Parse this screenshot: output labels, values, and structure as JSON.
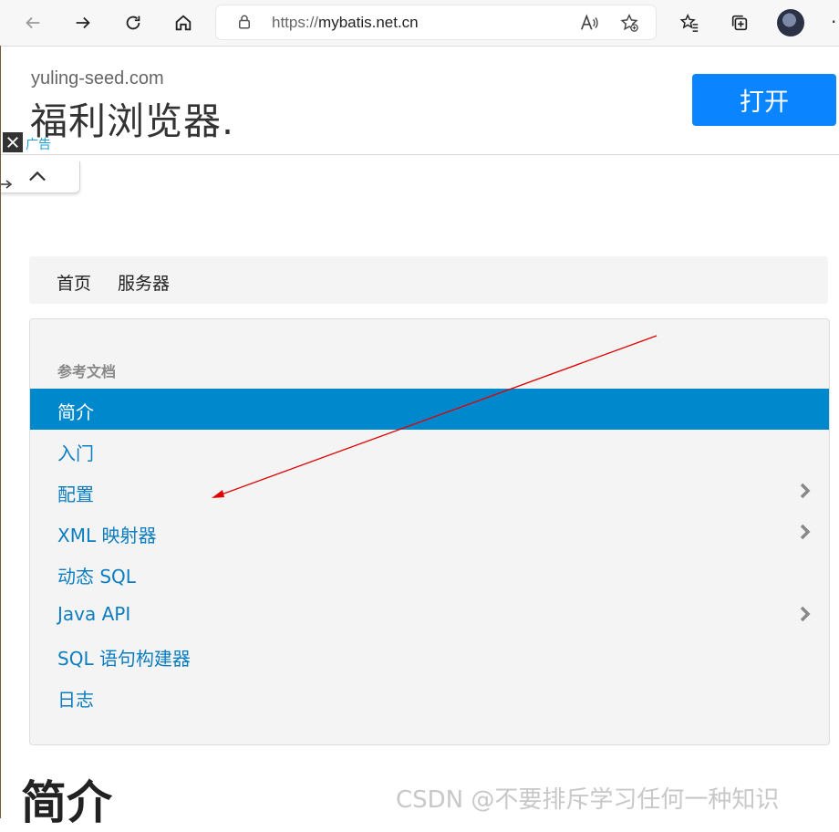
{
  "browser": {
    "url_scheme": "https://",
    "url_host": "mybatis.net.cn",
    "icons": [
      "back-icon",
      "forward-icon",
      "refresh-icon",
      "home-icon",
      "lock-icon",
      "read-aloud-icon",
      "add-favorite-icon",
      "favorites-icon",
      "collections-icon",
      "profile-avatar",
      "more-icon"
    ]
  },
  "ad": {
    "domain": "yuling-seed.com",
    "title": "福利浏览器.",
    "open_label": "打开",
    "ad_label": "广告"
  },
  "breadcrumb": {
    "home": "首页",
    "server": "服务器"
  },
  "sidebar": {
    "header": "参考文档",
    "items": [
      {
        "label": "简介",
        "active": true,
        "has_arrow": false
      },
      {
        "label": "入门",
        "active": false,
        "has_arrow": false
      },
      {
        "label": "配置",
        "active": false,
        "has_arrow": true
      },
      {
        "label": "XML 映射器",
        "active": false,
        "has_arrow": true
      },
      {
        "label": "动态 SQL",
        "active": false,
        "has_arrow": false
      },
      {
        "label": "Java API",
        "active": false,
        "has_arrow": true
      },
      {
        "label": "SQL 语句构建器",
        "active": false,
        "has_arrow": false
      },
      {
        "label": "日志",
        "active": false,
        "has_arrow": false
      }
    ]
  },
  "main": {
    "heading": "简介"
  },
  "watermark": "CSDN @不要排斥学习任何一种知识",
  "colors": {
    "active_bg": "#0088cc",
    "link": "#0b7dc0",
    "ad_button": "#0a84ff",
    "annotation": "#e00000"
  }
}
